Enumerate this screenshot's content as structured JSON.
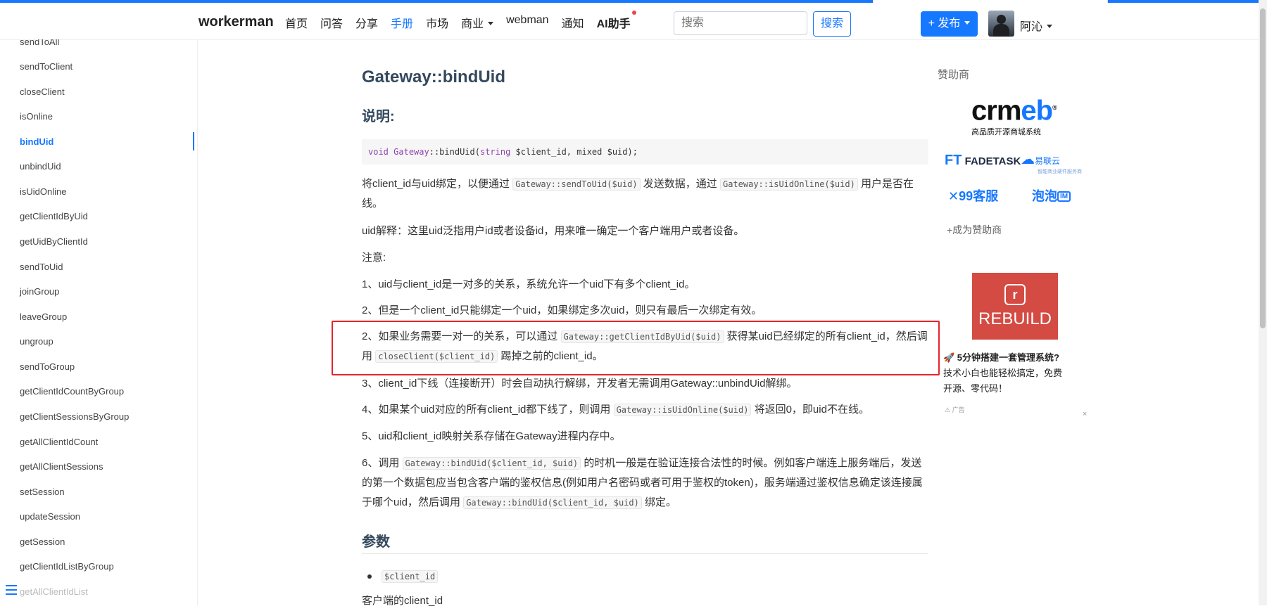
{
  "brand": "workerman",
  "nav": [
    {
      "label": "首页"
    },
    {
      "label": "问答"
    },
    {
      "label": "分享"
    },
    {
      "label": "手册"
    },
    {
      "label": "市场"
    },
    {
      "label": "商业"
    },
    {
      "label": "webman"
    },
    {
      "label": "通知"
    },
    {
      "label": "AI助手"
    }
  ],
  "search": {
    "placeholder": "搜索",
    "button": "搜索"
  },
  "publish": "+ 发布",
  "user": {
    "name": "阿沁"
  },
  "sidebar": {
    "items": [
      "sendToAll",
      "sendToClient",
      "closeClient",
      "isOnline",
      "bindUid",
      "unbindUid",
      "isUidOnline",
      "getClientIdByUid",
      "getUidByClientId",
      "sendToUid",
      "joinGroup",
      "leaveGroup",
      "ungroup",
      "sendToGroup",
      "getClientIdCountByGroup",
      "getClientSessionsByGroup",
      "getAllClientIdCount",
      "getAllClientSessions",
      "setSession",
      "updateSession",
      "getSession",
      "getClientIdListByGroup",
      "getAllClientIdList"
    ],
    "active": "bindUid"
  },
  "content": {
    "title": "Gateway::bindUid",
    "h_desc": "说明:",
    "signature": {
      "void": "void",
      "cls": "Gateway",
      "sep": "::",
      "fn": "bindUid(",
      "t1": "string",
      "a1": " $client_id, mixed $uid);"
    },
    "p1": {
      "a": "将client_id与uid绑定，以便通过",
      "c1": "Gateway::sendToUid($uid)",
      "b": "发送数据，通过",
      "c2": "Gateway::isUidOnline($uid)",
      "d": "用户是否在线。"
    },
    "p2": "uid解释：这里uid泛指用户id或者设备id，用来唯一确定一个客户端用户或者设备。",
    "p3": "注意:",
    "n1": "1、uid与client_id是一对多的关系，系统允许一个uid下有多个client_id。",
    "n2": "2、但是一个client_id只能绑定一个uid，如果绑定多次uid，则只有最后一次绑定有效。",
    "n3": {
      "a": "2、如果业务需要一对一的关系，可以通过",
      "c1": "Gateway::getClientIdByUid($uid)",
      "b": "获得某uid已经绑定的所有client_id，然后调用",
      "c2": "closeClient($client_id)",
      "d": "踢掉之前的client_id。"
    },
    "n4": "3、client_id下线（连接断开）时会自动执行解绑，开发者无需调用Gateway::unbindUid解绑。",
    "n5": {
      "a": "4、如果某个uid对应的所有client_id都下线了，则调用",
      "c1": "Gateway::isUidOnline($uid)",
      "b": "将返回0，即uid不在线。"
    },
    "n6": "5、uid和client_id映射关系存储在Gateway进程内存中。",
    "n7": {
      "a": "6、调用",
      "c1": "Gateway::bindUid($client_id, $uid)",
      "b": "的时机一般是在验证连接合法性的时候。例如客户端连上服务端后，发送的第一个数据包应当包含客户端的鉴权信息(例如用户名密码或者可用于鉴权的token)，服务端通过鉴权信息确定该连接属于哪个uid，然后调用",
      "c2": "Gateway::bindUid($client_id, $uid)",
      "d": "绑定。"
    },
    "h_params": "参数",
    "param1": "$client_id",
    "param1_desc": "客户端的client_id"
  },
  "aside": {
    "title": "赞助商",
    "crmeb": {
      "word_a": "crm",
      "word_b": "eb",
      "reg": "®",
      "sub": "高品质开源商城系统"
    },
    "fadetask": {
      "ft": "FT",
      "name": "FADETASK"
    },
    "yilianyun": {
      "name": "易联云",
      "sub": "智能商业硬件服务商"
    },
    "kf99": "99客服",
    "paopao": {
      "name": "泡泡",
      "im": "IM"
    },
    "become": "+成为赞助商",
    "ad": {
      "title": "REBUILD",
      "icon": "r",
      "bold": "🚀 5分钟搭建一套管理系统?",
      "rest": "技术小白也能轻松搞定，免费开源、零代码！",
      "label": "⚠ 广告",
      "close": "×"
    }
  },
  "colors": {
    "accent": "#1677ff",
    "highlight": "#e5252a",
    "ad_bg": "#d44b43"
  }
}
